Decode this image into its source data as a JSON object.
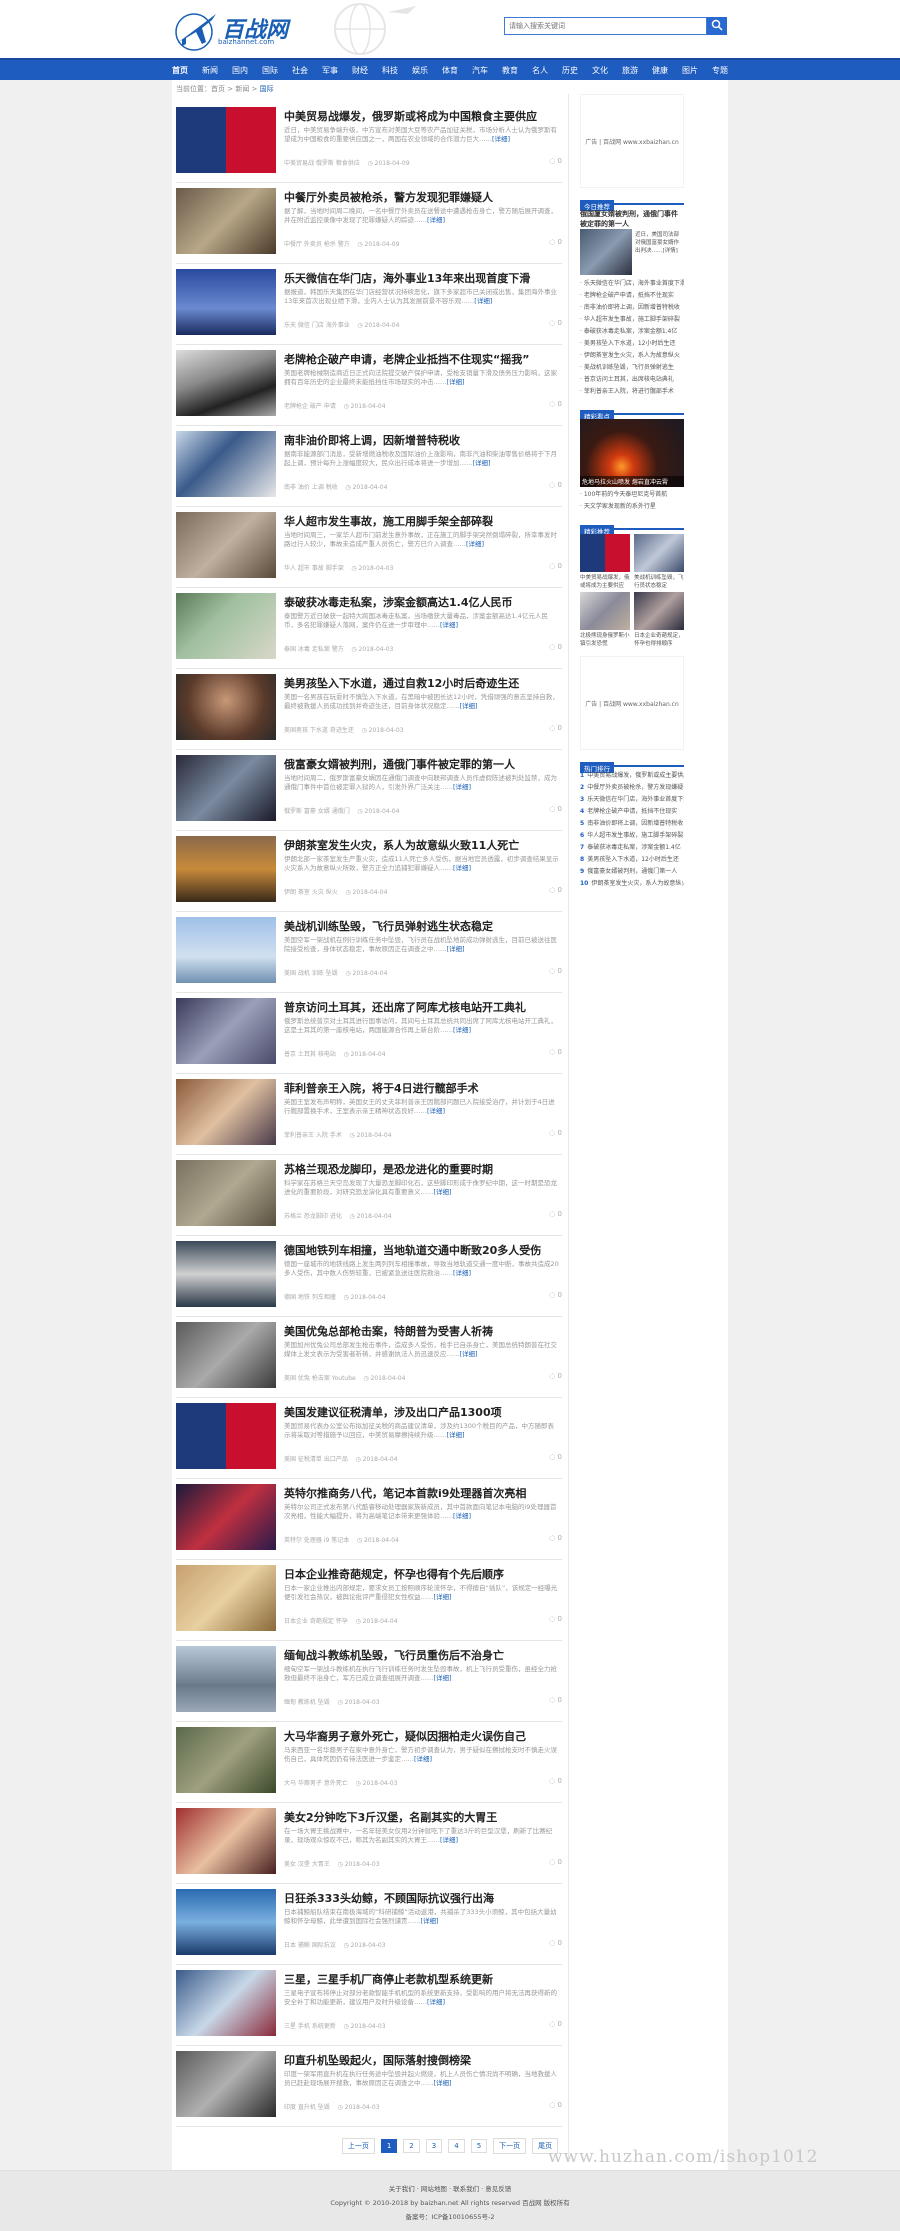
{
  "site": {
    "logo_text": "百战网",
    "logo_sub": "baizhannet.com",
    "search_placeholder": "请输入搜索关键词"
  },
  "nav": [
    "首页",
    "新闻",
    "国内",
    "国际",
    "社会",
    "军事",
    "财经",
    "科技",
    "娱乐",
    "体育",
    "汽车",
    "教育",
    "名人",
    "历史",
    "文化",
    "旅游",
    "健康",
    "图片",
    "专题"
  ],
  "breadcrumb": {
    "prefix": "当前位置：首页 > 新闻 > ",
    "current": "国际"
  },
  "articles": [
    {
      "title": "中美贸易战爆发，俄罗斯或将成为中国粮食主要供应",
      "summary": "近日，中美贸易争端升级，中方宣布对美国大豆等农产品加征关税，市场分析人士认为俄罗斯有望成为中国粮食的重要供应国之一，两国在农业领域的合作潜力巨大……",
      "meta": "中美贸易战   俄罗斯   粮食供应",
      "date": "2018-04-09",
      "comments": "0"
    },
    {
      "title": "中餐厅外卖员被枪杀，警方发现犯罪嫌疑人",
      "summary": "据了解，当地时间周二晚间，一名中餐厅外卖员在送餐途中遭遇枪击身亡，警方随后展开调查，并在附近监控录像中发现了犯罪嫌疑人的踪迹……",
      "meta": "中餐厅   外卖员   枪杀   警方",
      "date": "2018-04-09",
      "comments": "0"
    },
    {
      "title": "乐天微信在华门店，海外事业13年来出现首度下滑",
      "summary": "据报道，韩国乐天集团在华门店经营状况持续恶化，旗下多家超市已关闭或出售，集团海外事业13年来首次出现业绩下滑，业内人士认为其发展前景不容乐观……",
      "meta": "乐天   微信   门店   海外事业",
      "date": "2018-04-04",
      "comments": "0"
    },
    {
      "title": "老牌枪企破产申请，老牌企业抵挡不住现实“摇我”",
      "summary": "美国老牌枪械制造商近日正式向法院提交破产保护申请，受枪支销量下滑及债务压力影响，这家拥有百年历史的企业最终未能抵挡住市场现实的冲击……",
      "meta": "老牌枪企   破产   申请",
      "date": "2018-04-04",
      "comments": "0"
    },
    {
      "title": "南非油价即将上调，因新增普特税收",
      "summary": "据南非能源部门消息，受新增燃油税收及国际油价上涨影响，南非汽油和柴油零售价格将于下月起上调，预计每升上涨幅度较大，民众出行成本将进一步增加……",
      "meta": "南非   油价   上调   税收",
      "date": "2018-04-04",
      "comments": "0"
    },
    {
      "title": "华人超市发生事故，施工用脚手架全部碎裂",
      "summary": "当地时间周三，一家华人超市门前发生意外事故，正在施工的脚手架突然倒塌碎裂，所幸事发时路过行人较少，事故未造成严重人员伤亡，警方已介入调查……",
      "meta": "华人   超市   事故   脚手架",
      "date": "2018-04-03",
      "comments": "0"
    },
    {
      "title": "泰破获冰毒走私案，涉案金额高达1.4亿人民币",
      "summary": "泰国警方近日破获一起特大跨国冰毒走私案，当场缴获大量毒品，涉案金额高达1.4亿元人民币，多名犯罪嫌疑人落网，案件仍在进一步审理中……",
      "meta": "泰国   冰毒   走私案   警方",
      "date": "2018-04-03",
      "comments": "0"
    },
    {
      "title": "美男孩坠入下水道，通过自救12小时后奇迹生还",
      "summary": "美国一名男孩在玩耍时不慎坠入下水道，在黑暗中被困长达12小时，凭借顽强的意志坚持自救，最终被救援人员成功找到并奇迹生还，目前身体状况稳定……",
      "meta": "美国男孩   下水道   奇迹生还",
      "date": "2018-04-03",
      "comments": "0"
    },
    {
      "title": "俄富豪女婿被判刑，通俄门事件被定罪的第一人",
      "summary": "当地时间周二，俄罗斯富豪女婿因在通俄门调查中向联邦调查人员作虚假陈述被判处监禁，成为通俄门事件中首位被定罪入狱的人，引发外界广泛关注……",
      "meta": "俄罗斯   富豪   女婿   通俄门",
      "date": "2018-04-04",
      "comments": "0"
    },
    {
      "title": "伊朗茶室发生火灾，系人为故意纵火致11人死亡",
      "summary": "伊朗北部一家茶室发生严重火灾，造成11人死亡多人受伤，据当地官员透露，初步调查结果显示火灾系人为故意纵火所致，警方正全力追捕犯罪嫌疑人……",
      "meta": "伊朗   茶室   火灾   纵火",
      "date": "2018-04-04",
      "comments": "0"
    },
    {
      "title": "美战机训练坠毁，飞行员弹射逃生状态稳定",
      "summary": "美国空军一架战机在例行训练任务中坠毁，飞行员在战机坠地前成功弹射逃生，目前已被送往医院接受检查，身体状态稳定，事故原因正在调查之中……",
      "meta": "美国   战机   训练   坠毁",
      "date": "2018-04-04",
      "comments": "0"
    },
    {
      "title": "普京访问土耳其，还出席了阿库尤核电站开工典礼",
      "summary": "俄罗斯总统普京对土耳其进行国事访问，其间与土耳其总统共同出席了阿库尤核电站开工典礼，这是土耳其的第一座核电站，两国能源合作再上新台阶……",
      "meta": "普京   土耳其   核电站",
      "date": "2018-04-04",
      "comments": "0"
    },
    {
      "title": "菲利普亲王入院，将于4日进行髋部手术",
      "summary": "英国王室发布声明称，英国女王的丈夫菲利普亲王因髋部问题已入院接受治疗，并计划于4日进行髋部置换手术，王室表示亲王精神状态良好……",
      "meta": "菲利普亲王   入院   手术",
      "date": "2018-04-04",
      "comments": "0"
    },
    {
      "title": "苏格兰现恐龙脚印，是恐龙进化的重要时期",
      "summary": "科学家在苏格兰天空岛发现了大量恐龙脚印化石，这些脚印形成于侏罗纪中期，这一时期是恐龙进化的重要阶段，对研究恐龙演化具有重要意义……",
      "meta": "苏格兰   恐龙脚印   进化",
      "date": "2018-04-04",
      "comments": "0"
    },
    {
      "title": "德国地铁列车相撞，当地轨道交通中断致20多人受伤",
      "summary": "德国一座城市的地铁线路上发生两列列车相撞事故，导致当地轨道交通一度中断，事故共造成20多人受伤，其中数人伤势较重，已被紧急送往医院救治……",
      "meta": "德国   地铁   列车相撞",
      "date": "2018-04-04",
      "comments": "0"
    },
    {
      "title": "美国优兔总部枪击案，特朗普为受害人祈祷",
      "summary": "美国加州优兔公司总部发生枪击事件，造成多人受伤，枪手已自杀身亡，美国总统特朗普在社交媒体上发文表示为受害者祈祷，并感谢执法人员迅速反应……",
      "meta": "美国   优兔   枪击案   Youtube",
      "date": "2018-04-04",
      "comments": "0"
    },
    {
      "title": "美国发建议征税清单，涉及出口产品1300项",
      "summary": "美国贸易代表办公室公布拟加征关税的商品建议清单，涉及约1300个税目的产品，中方随即表示将采取对等措施予以回应，中美贸易摩擦持续升级……",
      "meta": "美国   征税清单   出口产品",
      "date": "2018-04-04",
      "comments": "0"
    },
    {
      "title": "英特尔推商务八代，笔记本首款i9处理器首次亮相",
      "summary": "英特尔公司正式发布第八代酷睿移动处理器家族新成员，其中首款面向笔记本电脑的i9处理器首次亮相，性能大幅提升，将为高端笔记本带来更强体验……",
      "meta": "英特尔   处理器   i9   笔记本",
      "date": "2018-04-04",
      "comments": "0"
    },
    {
      "title": "日本企业推奇葩规定，怀孕也得有个先后顺序",
      "summary": "日本一家企业推出内部规定，要求女员工按照顺序轮流怀孕，不得擅自“插队”，该规定一经曝光便引发社会热议，被舆论批评严重侵犯女性权益……",
      "meta": "日本企业   奇葩规定   怀孕",
      "date": "2018-04-04",
      "comments": "0"
    },
    {
      "title": "缅甸战斗教练机坠毁，飞行员重伤后不治身亡",
      "summary": "缅甸空军一架战斗教练机在执行飞行训练任务时发生坠毁事故，机上飞行员受重伤，虽经全力抢救但最终不治身亡，军方已成立调查组展开调查……",
      "meta": "缅甸   教练机   坠毁",
      "date": "2018-04-03",
      "comments": "0"
    },
    {
      "title": "大马华裔男子意外死亡，疑似因捆柏走火误伤自己",
      "summary": "马来西亚一名华裔男子在家中意外身亡，警方初步调查认为，男子疑似在擦拭枪支时不慎走火误伤自己，具体死因仍有待法医进一步鉴定……",
      "meta": "大马   华裔男子   意外死亡",
      "date": "2018-04-03",
      "comments": "0"
    },
    {
      "title": "美女2分钟吃下3斤汉堡，名副其实的大胃王",
      "summary": "在一场大胃王挑战赛中，一名年轻美女仅用2分钟就吃下了重达3斤的巨型汉堡，刷新了比赛纪录，现场观众惊叹不已，称其为名副其实的大胃王……",
      "meta": "美女   汉堡   大胃王",
      "date": "2018-04-03",
      "comments": "0"
    },
    {
      "title": "日狂杀333头幼鲸，不顾国际抗议强行出海",
      "summary": "日本捕鲸船队结束在南极海域的“科研捕鲸”活动返港，共捕杀了333头小须鲸，其中包括大量幼鲸和怀孕母鲸，此举遭到国际社会强烈谴责……",
      "meta": "日本   捕鲸   国际抗议",
      "date": "2018-04-03",
      "comments": "0"
    },
    {
      "title": "三星，三星手机厂商停止老款机型系统更新",
      "summary": "三星电子宣布将停止对部分老款智能手机机型的系统更新支持，受影响的用户将无法再获得新的安全补丁和功能更新，建议用户及时升级设备……",
      "meta": "三星   手机   系统更新",
      "date": "2018-04-03",
      "comments": "0"
    },
    {
      "title": "印直升机坠毁起火，国际落射搜倒榜梁",
      "summary": "印度一架军用直升机在执行任务途中坠毁并起火燃烧，机上人员伤亡情况尚不明确，当地救援人员已赶赴现场展开搜救，事故原因正在调查之中……",
      "meta": "印度   直升机   坠毁",
      "date": "2018-04-03",
      "comments": "0"
    }
  ],
  "sidebar": {
    "ad1": "广告 | 百战网 www.xxbaizhan.cn",
    "today_head": "今日推荐",
    "today_big": "俄国厦女婿被判刑，通俄门事件被定罪的第一人",
    "today_small": "近日，美国司法部对俄国富豪女婿作出判决……[详情]",
    "today_list": [
      "· 乐天微信在华门店，海外事业首度下滑",
      "· 老牌枪企破产申请，抵挡不住现实",
      "· 南非油价即将上调，因新增普特税收",
      "· 华人超市发生事故，施工脚手架碎裂",
      "· 泰破获冰毒走私案，涉案金额1.4亿",
      "· 美男孩坠入下水道，12小时后生还",
      "· 伊朗茶室发生火灾，系人为故意纵火",
      "· 美战机训练坠毁，飞行员弹射逃生",
      "· 普京访问土耳其，出席核电站典礼",
      "· 菲利普亲王入院，将进行髋部手术"
    ],
    "hot_head": "精彩看点",
    "hot_cap": "危地马拉火山喷发 熔岩直冲云霄",
    "hot_list": [
      "· 100年前的今天泰坦尼克号首航",
      "· 天文学家发现新的系外行星"
    ],
    "pic_head": "精彩推荐",
    "pic_items": [
      "中美贸易战爆发，俄或将成为主要供应",
      "美战机训练坠毁，飞行员状态稳定",
      "北极熊现身俄罗斯小镇引发恐慌",
      "日本企业奇葩规定，怀孕也得排顺序"
    ],
    "ad2": "广告 | 百战网 www.xxbaizhan.cn",
    "rank_head": "热门排行",
    "rank_list": [
      "中美贸易战爆发，俄罗斯或成主要供应",
      "中餐厅外卖员被枪杀，警方发现嫌疑人",
      "乐天微信在华门店，海外事业首度下滑",
      "老牌枪企破产申请，抵挡不住现实",
      "南非油价即将上调，因新增普特税收",
      "华人超市发生事故，施工脚手架碎裂",
      "泰破获冰毒走私案，涉案金额1.4亿",
      "美男孩坠入下水道，12小时后生还",
      "俄富豪女婿被判刑，通俄门第一人",
      "伊朗茶室发生火灾，系人为故意纵火"
    ]
  },
  "pager": {
    "first": "上一页",
    "pages": [
      "1",
      "2",
      "3",
      "4",
      "5"
    ],
    "next": "下一页",
    "last": "尾页"
  },
  "footer": {
    "line1": "关于我们 · 网站地图 · 联系我们 · 意见反馈",
    "line2": "Copyright © 2010-2018 by baizhan.net All rights reserved 百战网 版权所有",
    "line3": "备案号：ICP备10010655号-2"
  },
  "watermark": "www.huzhan.com/ishop1012"
}
